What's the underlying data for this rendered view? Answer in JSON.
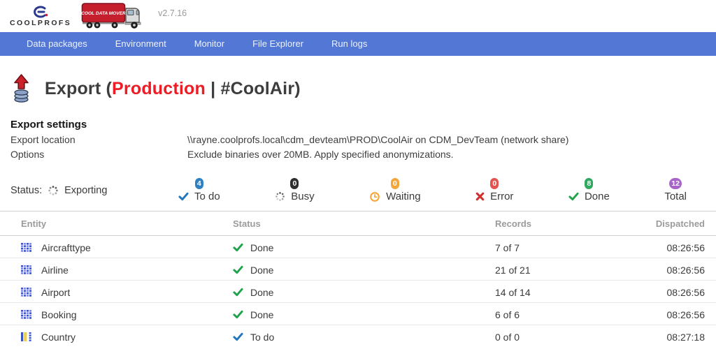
{
  "header": {
    "brand": "COOLPROFS",
    "truck_label": "COOL DATA MOVER",
    "version": "v2.7.16"
  },
  "nav": {
    "items": [
      {
        "label": "Data packages"
      },
      {
        "label": "Environment"
      },
      {
        "label": "Monitor"
      },
      {
        "label": "File Explorer"
      },
      {
        "label": "Run logs"
      }
    ]
  },
  "page": {
    "title_prefix": "Export (",
    "title_environment": "Production",
    "title_suffix": " | #CoolAir)"
  },
  "settings": {
    "heading": "Export settings",
    "rows": [
      {
        "label": "Export location",
        "value": "\\\\rayne.coolprofs.local\\cdm_devteam\\PROD\\CoolAir on CDM_DevTeam (network share)"
      },
      {
        "label": "Options",
        "value": "Exclude binaries over 20MB. Apply specified anonymizations."
      }
    ]
  },
  "status": {
    "label": "Status:",
    "state": "Exporting",
    "counters": [
      {
        "key": "todo",
        "count": "4",
        "label": "To do",
        "badge_color": "#2d80c2"
      },
      {
        "key": "busy",
        "count": "0",
        "label": "Busy",
        "badge_color": "#2f2f2f"
      },
      {
        "key": "waiting",
        "count": "0",
        "label": "Waiting",
        "badge_color": "#f2a73d"
      },
      {
        "key": "error",
        "count": "0",
        "label": "Error",
        "badge_color": "#e4534f"
      },
      {
        "key": "done",
        "count": "8",
        "label": "Done",
        "badge_color": "#2fa860"
      },
      {
        "key": "total",
        "count": "12",
        "label": "Total",
        "badge_color": "#a964c7"
      }
    ]
  },
  "table": {
    "columns": [
      "Entity",
      "Status",
      "Records",
      "Dispatched"
    ],
    "rows": [
      {
        "entity": "Aircrafttype",
        "icon": "table-grid",
        "status": "Done",
        "status_key": "done",
        "records": "7 of 7",
        "dispatched": "08:26:56"
      },
      {
        "entity": "Airline",
        "icon": "table-grid",
        "status": "Done",
        "status_key": "done",
        "records": "21 of 21",
        "dispatched": "08:26:56"
      },
      {
        "entity": "Airport",
        "icon": "table-grid",
        "status": "Done",
        "status_key": "done",
        "records": "14 of 14",
        "dispatched": "08:26:56"
      },
      {
        "entity": "Booking",
        "icon": "table-grid",
        "status": "Done",
        "status_key": "done",
        "records": "6 of 6",
        "dispatched": "08:26:56"
      },
      {
        "entity": "Country",
        "icon": "table-partial",
        "status": "To do",
        "status_key": "todo",
        "records": "0 of 0",
        "dispatched": "08:27:18"
      }
    ]
  },
  "icons": {
    "coolprofs-logo-icon": "blue-c-mark-with-red-dot",
    "truck-icon": "red-cartoon-semi-truck",
    "export-icon": "red-up-arrow-over-database",
    "spinner-icon": "dotted-circle-spinner",
    "todo-check-icon": "blue-checkmark",
    "busy-spinner-icon": "dotted-circle-spinner",
    "waiting-clock-icon": "orange-clock",
    "error-cross-icon": "red-x",
    "done-check-icon": "green-checkmark",
    "entity-table-icon": "blue-grid-table",
    "entity-partial-table-icon": "blue-yellow-striped-table"
  },
  "colors": {
    "nav_background": "#5277d4",
    "environment_red": "#ee1c25",
    "todo_blue": "#2176bd",
    "busy_dark": "#2f2f2f",
    "waiting_orange": "#f2a73d",
    "error_red": "#d32f2f",
    "done_green": "#22a24c",
    "total_purple": "#a964c7"
  }
}
